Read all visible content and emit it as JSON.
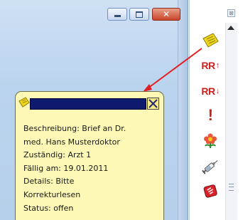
{
  "window": {
    "buttons": [
      {
        "name": "minimize-button",
        "icon": "minimize-icon"
      },
      {
        "name": "maximize-button",
        "icon": "maximize-icon"
      },
      {
        "name": "close-button",
        "icon": "close-icon"
      }
    ]
  },
  "toolbar": {
    "close_glyph": "⊠",
    "items": [
      {
        "name": "sticky-note-icon"
      },
      {
        "name": "rr-up-icon",
        "label": "RR",
        "arrow": "↑"
      },
      {
        "name": "rr-down-icon",
        "label": "RR",
        "arrow": "↓"
      },
      {
        "name": "exclamation-icon",
        "label": "!"
      },
      {
        "name": "flower-icon"
      },
      {
        "name": "syringe-icon"
      },
      {
        "name": "red-stamp-icon"
      }
    ]
  },
  "note": {
    "close_glyph": "✕",
    "lines": [
      "Beschreibung: Brief an Dr.",
      "med. Hans Musterdoktor",
      "Zuständig: Arzt 1",
      "Fällig am: 19.01.2011",
      "Details: Bitte",
      "Korrekturlesen",
      "Status: offen"
    ]
  },
  "colors": {
    "note_background": "#fdf8b5",
    "note_titlebar": "#0d1a6e",
    "arrow": "#e02020",
    "icon_red": "#cc1f1f"
  }
}
